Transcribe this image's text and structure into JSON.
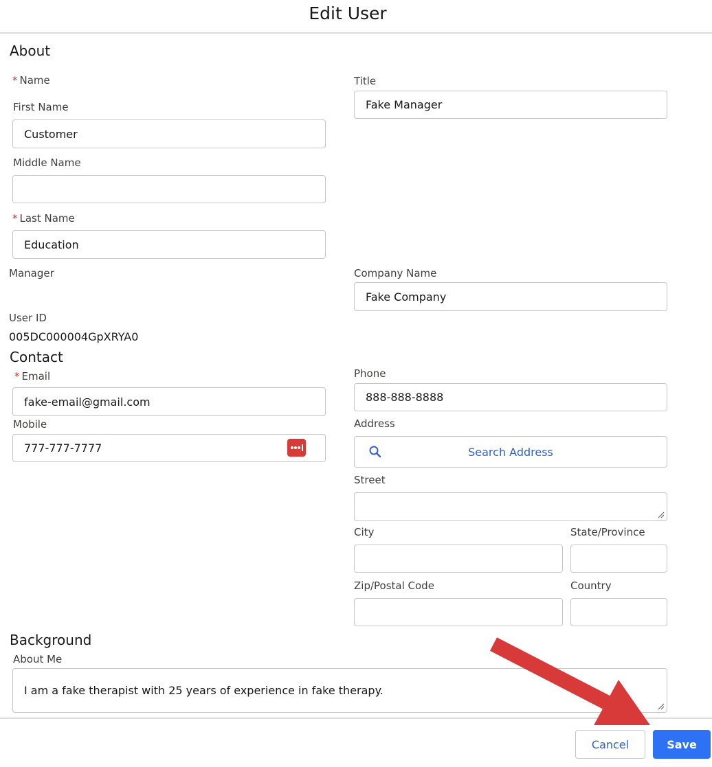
{
  "modal": {
    "title": "Edit User"
  },
  "about": {
    "heading": "About",
    "name_label": "Name",
    "first_name": {
      "label": "First Name",
      "value": "Customer"
    },
    "middle_name": {
      "label": "Middle Name",
      "value": ""
    },
    "last_name": {
      "label": "Last Name",
      "value": "Education"
    },
    "title": {
      "label": "Title",
      "value": "Fake Manager"
    },
    "manager": {
      "label": "Manager"
    },
    "company": {
      "label": "Company Name",
      "value": "Fake Company"
    },
    "user_id": {
      "label": "User ID",
      "value": "005DC000004GpXRYA0"
    }
  },
  "contact": {
    "heading": "Contact",
    "email": {
      "label": "Email",
      "value": "fake-email@gmail.com"
    },
    "mobile": {
      "label": "Mobile",
      "value": "777-777-7777"
    },
    "phone": {
      "label": "Phone",
      "value": "888-888-8888"
    },
    "address": {
      "label": "Address",
      "search_label": "Search Address"
    },
    "street": {
      "label": "Street",
      "value": ""
    },
    "city": {
      "label": "City",
      "value": ""
    },
    "state": {
      "label": "State/Province",
      "value": ""
    },
    "zip": {
      "label": "Zip/Postal Code",
      "value": ""
    },
    "country": {
      "label": "Country",
      "value": ""
    }
  },
  "background": {
    "heading": "Background",
    "about_me": {
      "label": "About Me",
      "value": "I am a fake therapist with 25 years of experience in fake therapy."
    }
  },
  "footer": {
    "cancel_label": "Cancel",
    "save_label": "Save"
  },
  "icons": {
    "search": "search-icon",
    "password_manager": "password-manager-icon",
    "annotation_arrow": "arrow-icon"
  },
  "colors": {
    "brand": "#1b5ae8",
    "save_bg": "#2d72f5",
    "required": "#c23934",
    "arrow": "#d83a3a",
    "link": "#2f62c9"
  }
}
